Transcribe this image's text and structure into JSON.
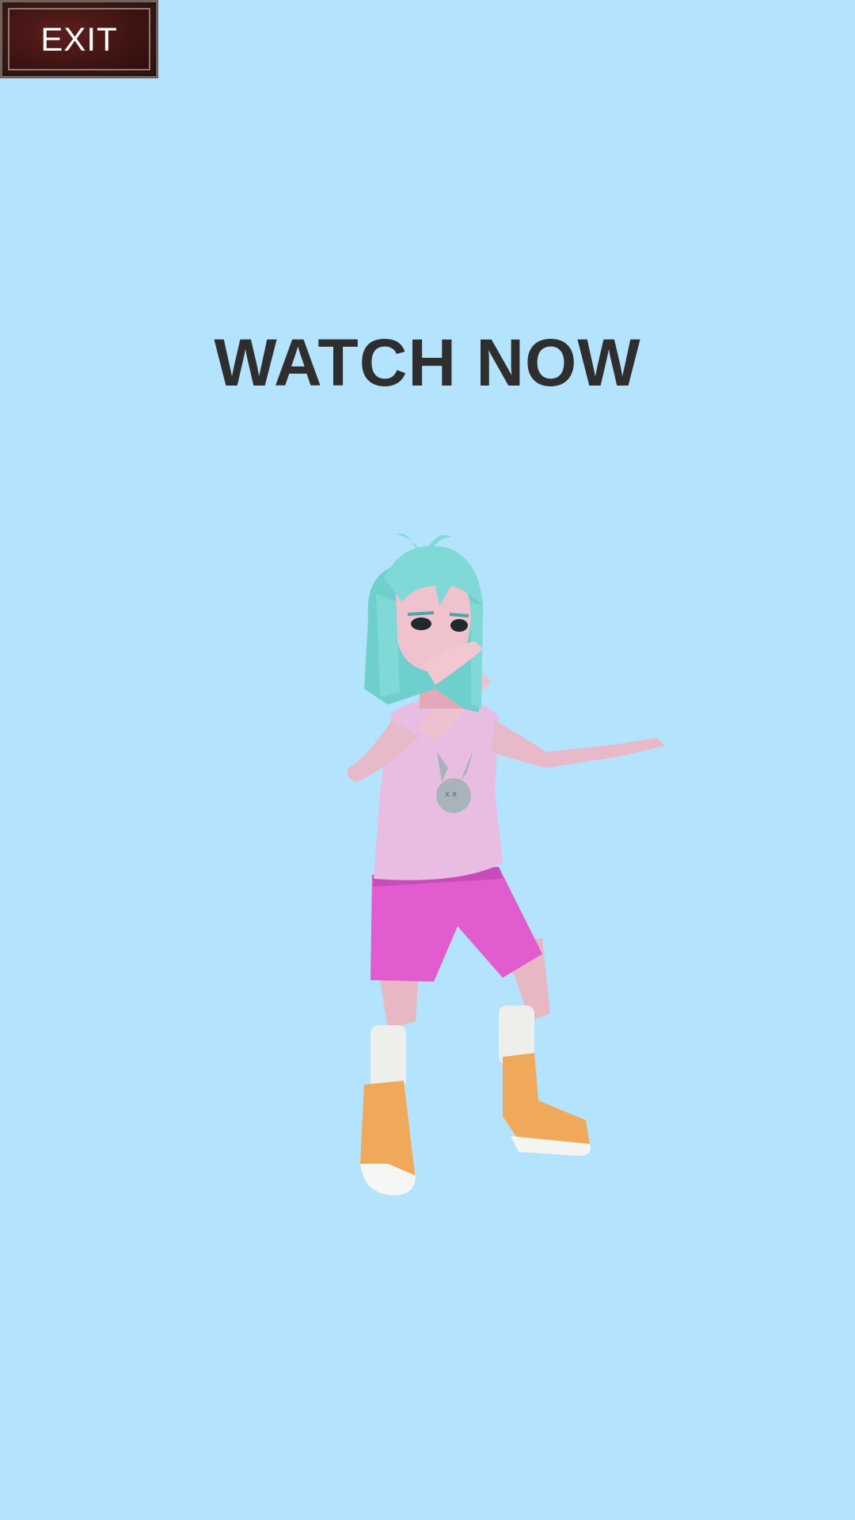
{
  "exit_button": {
    "label": "EXIT"
  },
  "headline": {
    "text": "WATCH NOW"
  },
  "character": {
    "icon": "dancing-girl-character"
  },
  "colors": {
    "background": "#b3e3fd",
    "headline": "#2f2e2e",
    "exit_button_bg": "#3f1412",
    "hair": "#7fd9d6",
    "shirt": "#e6b8de",
    "shorts": "#e05ccf",
    "boots": "#f0a95a"
  }
}
